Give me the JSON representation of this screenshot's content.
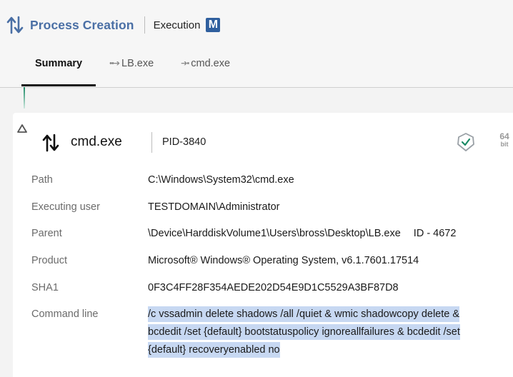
{
  "header": {
    "title": "Process Creation",
    "subtitle": "Execution",
    "mitre_badge": "M",
    "icon": "process-arrows-icon",
    "title_color": "#4a6fa5"
  },
  "tabs": [
    {
      "label": "Summary",
      "active": true
    },
    {
      "label": "LB.exe",
      "glyph": "••➔",
      "active": false
    },
    {
      "label": "cmd.exe",
      "glyph": "➔•",
      "active": false
    }
  ],
  "process": {
    "name": "cmd.exe",
    "pid": "PID-3840",
    "architecture_number": "64",
    "architecture_unit": "bit",
    "signature_icon": "verified-shield-icon"
  },
  "details": {
    "path": {
      "label": "Path",
      "value": "C:\\Windows\\System32\\cmd.exe"
    },
    "executing_user": {
      "label": "Executing user",
      "value": "TESTDOMAIN\\Administrator"
    },
    "parent": {
      "label": "Parent",
      "value": "\\Device\\HarddiskVolume1\\Users\\bross\\Desktop\\LB.exe",
      "id": "ID - 4672"
    },
    "product": {
      "label": "Product",
      "value": "Microsoft® Windows® Operating System, v6.1.7601.17514"
    },
    "sha1": {
      "label": "SHA1",
      "value": "0F3C4FF28F354AEDE202D54E9D1C5529A3BF87D8"
    },
    "command_line": {
      "label": "Command line",
      "value": "/c vssadmin delete shadows /all /quiet & wmic shadowcopy delete & bcdedit /set {default} bootstatuspolicy ignoreallfailures & bcdedit /set {default} recoveryenabled no"
    }
  },
  "colors": {
    "accent": "#4a6fa5",
    "selection_highlight": "#c7d8f2",
    "timeline": "#1b8a65"
  }
}
